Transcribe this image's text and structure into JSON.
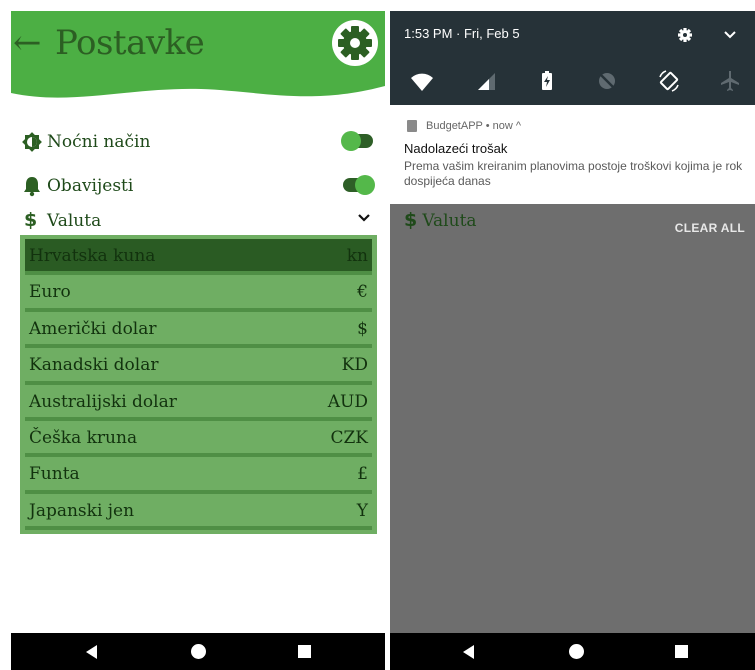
{
  "settings": {
    "title": "Postavke",
    "rows": {
      "night_mode": {
        "label": "Noćni način",
        "toggle": "off"
      },
      "notifications": {
        "label": "Obavijesti",
        "toggle": "on"
      },
      "currency": {
        "label": "Valuta"
      }
    },
    "currency_list": [
      {
        "name": "Hrvatska kuna",
        "symbol": "kn",
        "selected": true
      },
      {
        "name": "Euro",
        "symbol": "€",
        "selected": false
      },
      {
        "name": "Američki dolar",
        "symbol": "$",
        "selected": false
      },
      {
        "name": "Kanadski dolar",
        "symbol": "KD",
        "selected": false
      },
      {
        "name": "Australijski dolar",
        "symbol": "AUD",
        "selected": false
      },
      {
        "name": "Češka kruna",
        "symbol": "CZK",
        "selected": false
      },
      {
        "name": "Funta",
        "symbol": "£",
        "selected": false
      },
      {
        "name": "Japanski jen",
        "symbol": "Y",
        "selected": false
      }
    ],
    "colors": {
      "header": "#4caf44",
      "title": "#2c5f23",
      "list_bg": "#6fae63",
      "selected_row": "#2a5b23"
    }
  },
  "notification_shade": {
    "time": "1:53 PM · Fri, Feb 5",
    "quick_settings": [
      "wifi-icon",
      "signal-icon",
      "battery-charging-icon",
      "auto-sync-off-icon",
      "auto-rotate-icon",
      "airplane-mode-icon"
    ],
    "notification": {
      "app_line": "BudgetAPP • now ^",
      "title": "Nadolazeći trošak",
      "text": "Prema vašim kreiranim planovima postoje troškovi kojima je rok dospijeća danas"
    },
    "background_label": "Valuta",
    "clear_all": "CLEAR ALL"
  },
  "navbar": [
    "back-icon",
    "home-icon",
    "recents-icon"
  ]
}
